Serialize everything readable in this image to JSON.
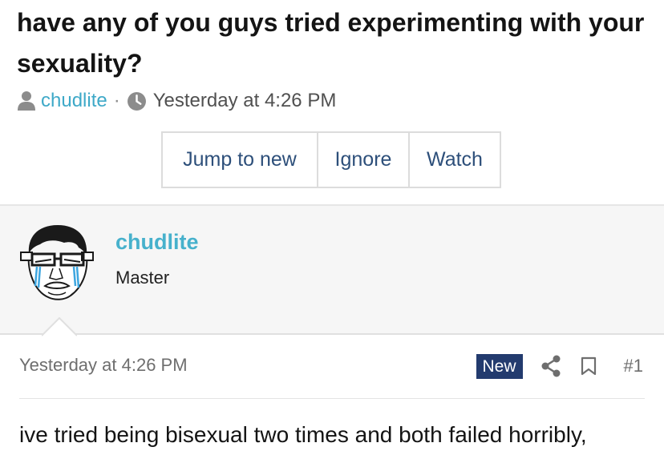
{
  "thread": {
    "title": "have any of you guys tried experimenting with your sexuality?",
    "author": "chudlite",
    "separator": "·",
    "timestamp": "Yesterday at 4:26 PM"
  },
  "buttons": {
    "jump_to_new": "Jump to new",
    "ignore": "Ignore",
    "watch": "Watch"
  },
  "post": {
    "username": "chudlite",
    "user_title": "Master",
    "date": "Yesterday at 4:26 PM",
    "new_badge": "New",
    "number": "#1",
    "body": "ive tried being bisexual two times and both failed horribly,"
  },
  "icons": {
    "author": "person-icon",
    "time": "clock-icon",
    "share": "share-icon",
    "bookmark": "bookmark-icon"
  },
  "colors": {
    "link": "#3ea9c8",
    "button_text": "#2d4f7a",
    "new_badge_bg": "#233b6e",
    "user_block_bg": "#f6f6f6"
  }
}
